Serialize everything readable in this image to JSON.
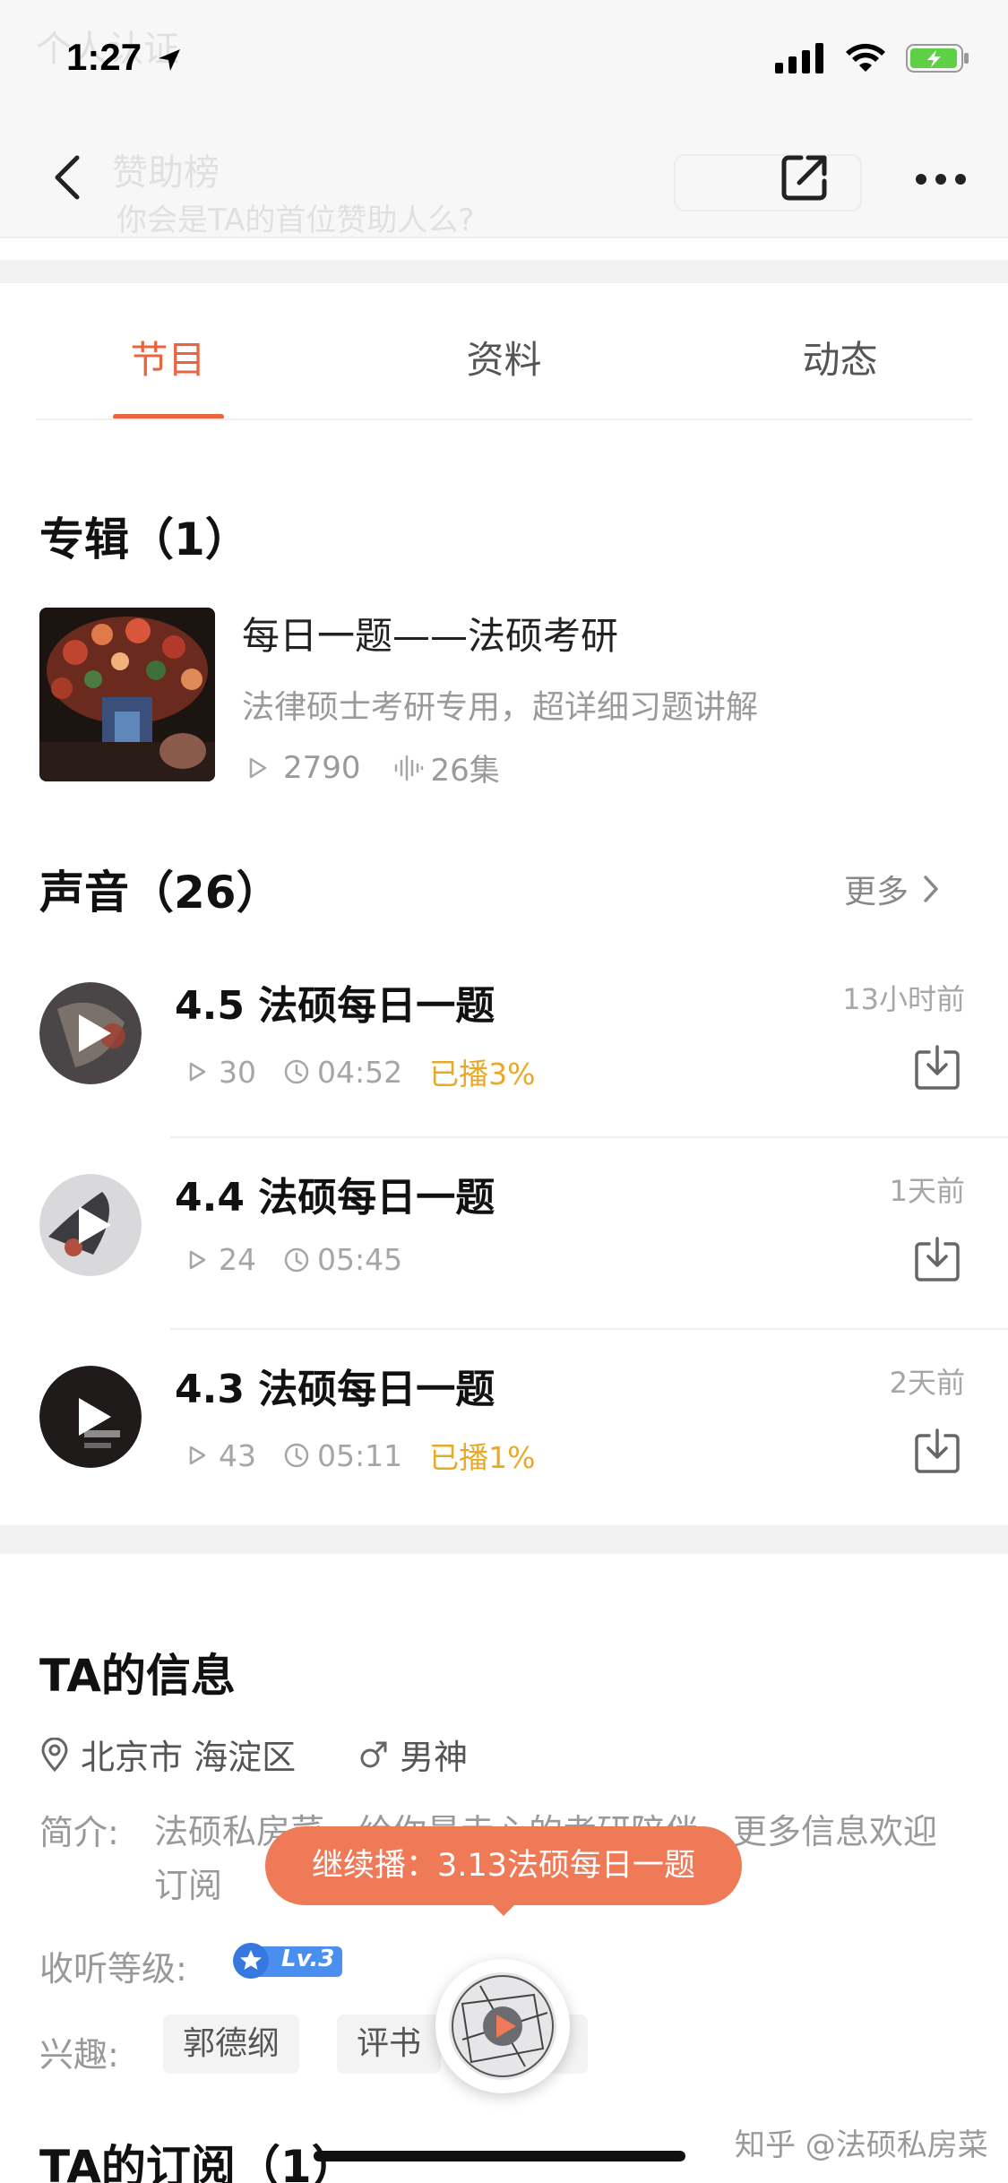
{
  "status_bar": {
    "time": "1:27"
  },
  "header": {
    "ghost_title": "个人认证",
    "ghost_name": "赞助榜",
    "ghost_subtitle": "你会是TA的首位赞助人么?"
  },
  "tabs": [
    {
      "label": "节目",
      "active": true
    },
    {
      "label": "资料",
      "active": false
    },
    {
      "label": "动态",
      "active": false
    }
  ],
  "albums_section": {
    "title": "专辑（1）",
    "album": {
      "title": "每日一题——法硕考研",
      "description": "法律硕士考研专用，超详细习题讲解",
      "plays": "2790",
      "episodes": "26集"
    }
  },
  "sounds_section": {
    "title": "声音（26）",
    "more_label": "更多",
    "tracks": [
      {
        "title": "4.5 法硕每日一题",
        "plays": "30",
        "duration": "04:52",
        "progress": "已播3%",
        "time": "13小时前"
      },
      {
        "title": "4.4 法硕每日一题",
        "plays": "24",
        "duration": "05:45",
        "progress": "",
        "time": "1天前"
      },
      {
        "title": "4.3 法硕每日一题",
        "plays": "43",
        "duration": "05:11",
        "progress": "已播1%",
        "time": "2天前"
      }
    ]
  },
  "info_section": {
    "title": "TA的信息",
    "location": "北京市 海淀区",
    "gender": "男神",
    "intro_label": "简介:",
    "intro_text": "法硕私房菜，给你最走心的考研陪伴。更多信息欢迎订阅",
    "level_label": "收听等级:",
    "level": "Lv.3",
    "interests_label": "兴趣:",
    "interests": [
      "郭德纲",
      "评书"
    ]
  },
  "subscriptions_section": {
    "title": "TA的订阅（1）"
  },
  "resume_toast": "继续播：3.13法硕每日一题",
  "watermark": "知乎 @法硕私房菜",
  "colors": {
    "accent": "#e8653f",
    "played": "#e9a928",
    "toast": "#ef7a58"
  }
}
